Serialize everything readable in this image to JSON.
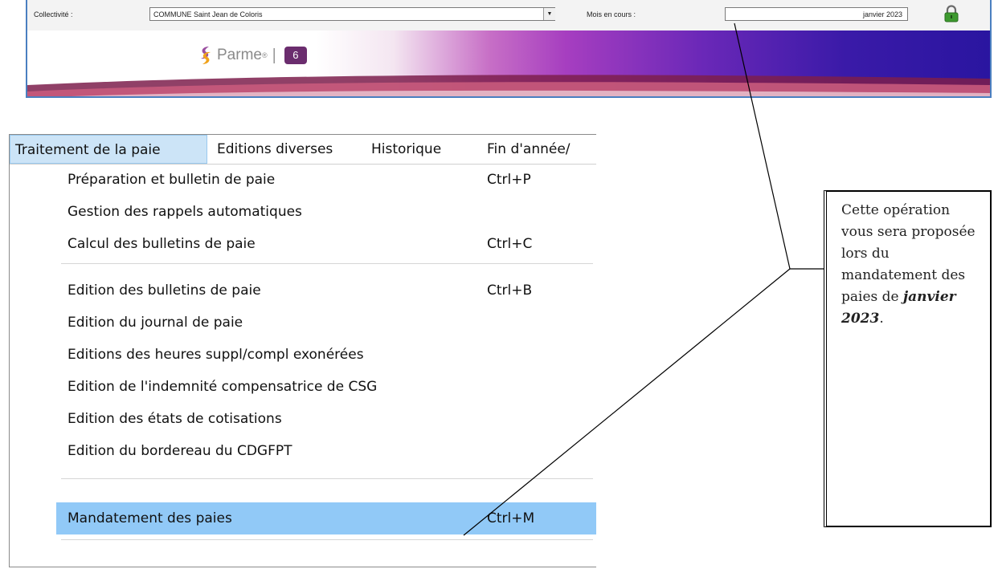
{
  "toolbar": {
    "collectivite_label": "Collectivité :",
    "collectivite_value": "COMMUNE  Saint Jean de Coloris",
    "mois_label": "Mois en cours :",
    "mois_value": "janvier 2023",
    "lock_icon": "lock-icon",
    "lock_color": "#3d9a2f"
  },
  "brand": {
    "name": "Parme",
    "reg": "®",
    "separator": "|",
    "version": "6",
    "version_color": "#6b2d6e"
  },
  "menubar": {
    "items": [
      {
        "label": "Traitement de la paie",
        "active": true
      },
      {
        "label": "Editions diverses",
        "active": false
      },
      {
        "label": "Historique",
        "active": false
      },
      {
        "label": "Fin d'année/",
        "active": false
      }
    ]
  },
  "dropdown": {
    "items": [
      {
        "label": "Préparation et bulletin de paie",
        "shortcut": "Ctrl+P"
      },
      {
        "label": "Gestion des rappels automatiques",
        "shortcut": ""
      },
      {
        "label": "Calcul des bulletins de paie",
        "shortcut": "Ctrl+C"
      },
      {
        "label": "Edition des bulletins de paie",
        "shortcut": "Ctrl+B"
      },
      {
        "label": "Edition du journal de paie",
        "shortcut": ""
      },
      {
        "label": "Editions des heures suppl/compl exonérées",
        "shortcut": ""
      },
      {
        "label": "Edition de l'indemnité compensatrice de CSG",
        "shortcut": ""
      },
      {
        "label": "Edition des états de cotisations",
        "shortcut": ""
      },
      {
        "label": "Edition du bordereau du CDGFPT",
        "shortcut": ""
      },
      {
        "label": "Mandatement des paies",
        "shortcut": "Ctrl+M",
        "selected": true
      }
    ],
    "selected_color": "#91c9f7"
  },
  "callout": {
    "text": "Cette opération vous sera proposée lors du mandatement des paies de ",
    "emphasis": "janvier 2023",
    "end": "."
  }
}
